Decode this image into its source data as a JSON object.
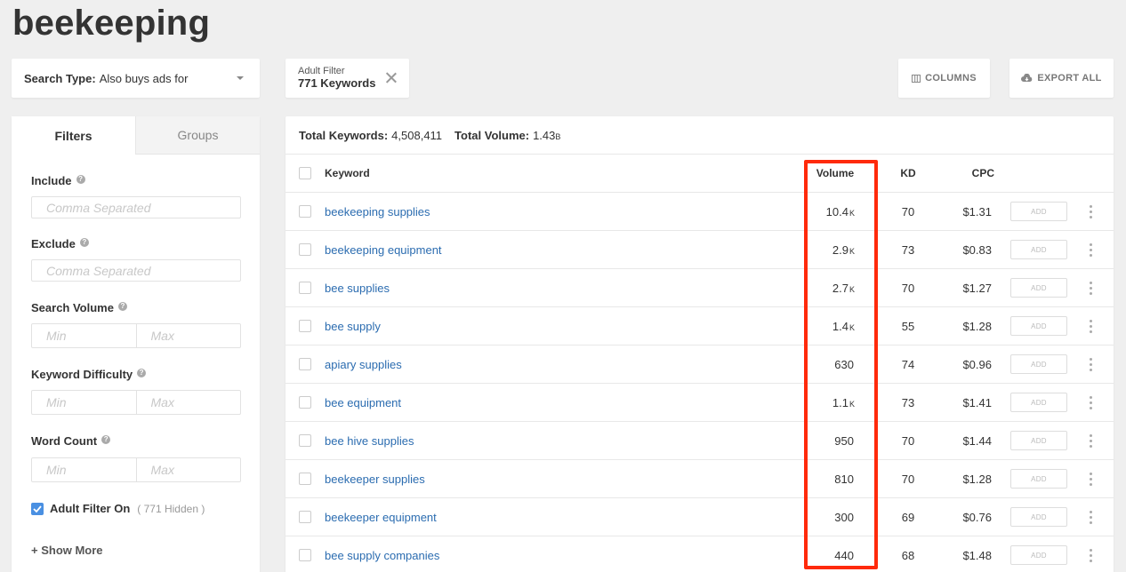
{
  "page": {
    "title": "beekeeping"
  },
  "search_type": {
    "label": "Search Type:",
    "value": "Also buys ads for"
  },
  "adult_filter_chip": {
    "title": "Adult Filter",
    "value": "771 Keywords"
  },
  "toolbar": {
    "columns_label": "COLUMNS",
    "export_label": "EXPORT ALL"
  },
  "sidebar": {
    "tabs": [
      {
        "label": "Filters",
        "active": true
      },
      {
        "label": "Groups",
        "active": false
      }
    ],
    "include": {
      "label": "Include",
      "placeholder": "Comma Separated"
    },
    "exclude": {
      "label": "Exclude",
      "placeholder": "Comma Separated"
    },
    "search_volume": {
      "label": "Search Volume",
      "min": "Min",
      "max": "Max"
    },
    "keyword_difficulty": {
      "label": "Keyword Difficulty",
      "min": "Min",
      "max": "Max"
    },
    "word_count": {
      "label": "Word Count",
      "min": "Min",
      "max": "Max"
    },
    "adult_filter": {
      "label": "Adult Filter On",
      "hidden": "( 771 Hidden )",
      "checked": true
    },
    "show_more": "+ Show More"
  },
  "summary": {
    "total_keywords_label": "Total Keywords:",
    "total_keywords": "4,508,411",
    "total_volume_label": "Total Volume:",
    "total_volume": "1.43",
    "total_volume_unit": "B"
  },
  "table": {
    "columns": {
      "keyword": "Keyword",
      "volume": "Volume",
      "kd": "KD",
      "cpc": "CPC"
    },
    "add_label": "ADD",
    "rows": [
      {
        "keyword": "beekeeping supplies",
        "volume": "10.4",
        "unit": "K",
        "kd": "70",
        "cpc": "$1.31"
      },
      {
        "keyword": "beekeeping equipment",
        "volume": "2.9",
        "unit": "K",
        "kd": "73",
        "cpc": "$0.83"
      },
      {
        "keyword": "bee supplies",
        "volume": "2.7",
        "unit": "K",
        "kd": "70",
        "cpc": "$1.27"
      },
      {
        "keyword": "bee supply",
        "volume": "1.4",
        "unit": "K",
        "kd": "55",
        "cpc": "$1.28"
      },
      {
        "keyword": "apiary supplies",
        "volume": "630",
        "unit": "",
        "kd": "74",
        "cpc": "$0.96"
      },
      {
        "keyword": "bee equipment",
        "volume": "1.1",
        "unit": "K",
        "kd": "73",
        "cpc": "$1.41"
      },
      {
        "keyword": "bee hive supplies",
        "volume": "950",
        "unit": "",
        "kd": "70",
        "cpc": "$1.44"
      },
      {
        "keyword": "beekeeper supplies",
        "volume": "810",
        "unit": "",
        "kd": "70",
        "cpc": "$1.28"
      },
      {
        "keyword": "beekeeper equipment",
        "volume": "300",
        "unit": "",
        "kd": "69",
        "cpc": "$0.76"
      },
      {
        "keyword": "bee supply companies",
        "volume": "440",
        "unit": "",
        "kd": "68",
        "cpc": "$1.48"
      }
    ]
  },
  "colors": {
    "link": "#2b6cb0",
    "highlight": "#ff2a0b",
    "checkbox": "#4a90e2"
  }
}
